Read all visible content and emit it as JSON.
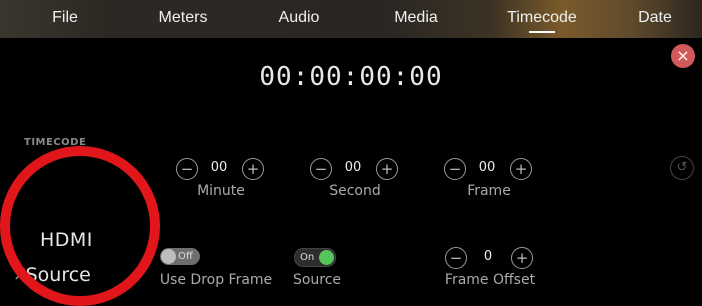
{
  "tabs": [
    {
      "label": "File"
    },
    {
      "label": "Meters"
    },
    {
      "label": "Audio"
    },
    {
      "label": "Media"
    },
    {
      "label": "Timecode"
    },
    {
      "label": "Date"
    }
  ],
  "active_tab": "Timecode",
  "timecode_display": "00:00:00:00",
  "section_title": "TIMECODE",
  "steppers": [
    {
      "value": "00",
      "label": "Minute"
    },
    {
      "value": "00",
      "label": "Second"
    },
    {
      "value": "00",
      "label": "Frame"
    }
  ],
  "frame_offset": {
    "value": "0",
    "label": "Frame Offset"
  },
  "toggles": [
    {
      "state": "Off",
      "label": "Use Drop Frame"
    },
    {
      "state": "On",
      "label": "Source"
    }
  ],
  "side_menu": {
    "line1": "HDMI",
    "line2": "Source",
    "chevron": "›"
  },
  "icons": {
    "close": "×",
    "minus": "−",
    "plus": "+",
    "reset": "↺"
  },
  "colors": {
    "close": "#d25a5a",
    "toggle_on": "#55c45a",
    "annotation_circle": "#e0161a"
  }
}
